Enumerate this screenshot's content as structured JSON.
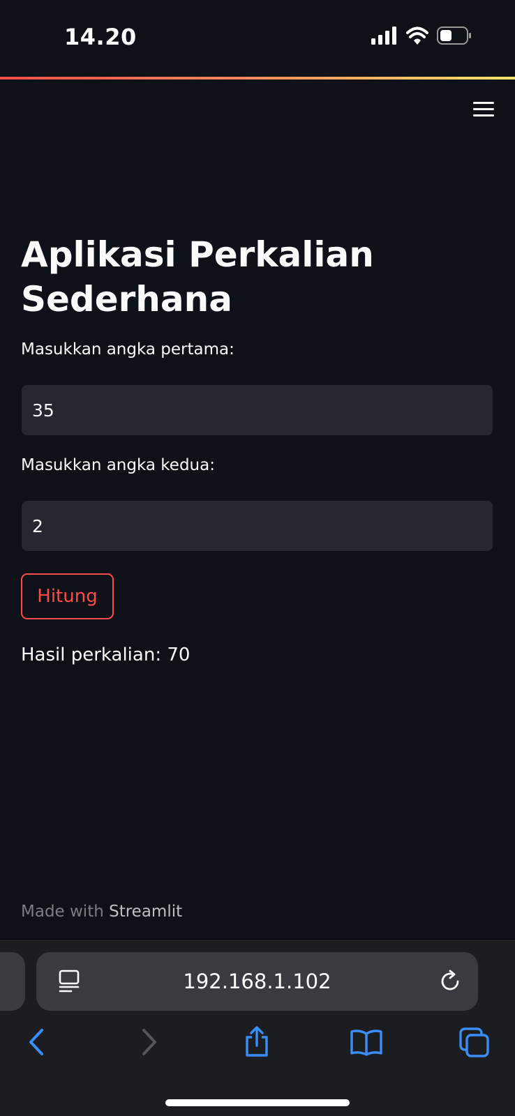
{
  "status_bar": {
    "time": "14.20",
    "icons": [
      "signal-icon",
      "wifi-icon",
      "battery-icon"
    ]
  },
  "app": {
    "title": "Aplikasi Perkalian Sederhana",
    "first_input": {
      "label": "Masukkan angka pertama:",
      "value": "35"
    },
    "second_input": {
      "label": "Masukkan angka kedua:",
      "value": "2"
    },
    "button_label": "Hitung",
    "result_text": "Hasil perkalian: 70",
    "footer": {
      "prefix": "Made with",
      "brand": "Streamlit"
    }
  },
  "browser": {
    "url": "192.168.1.102",
    "nav_icons": [
      "back-icon",
      "forward-icon",
      "share-icon",
      "bookmarks-icon",
      "tabs-icon"
    ]
  },
  "colors": {
    "background": "#0e1117",
    "input_bg": "#262730",
    "accent": "#ff4b4b",
    "link_blue": "#3a8ef6"
  }
}
